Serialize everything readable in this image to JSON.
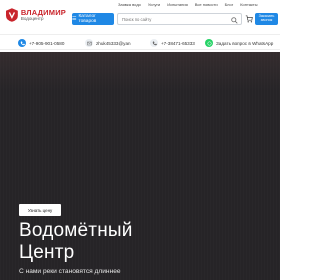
{
  "logo": {
    "title": "ВЛАДИМИР",
    "subtitle": "Водоцентр"
  },
  "menu": {
    "items": [
      "Заявка водо",
      "Услуги",
      "Испытания",
      "Все новости",
      "Блог",
      "Контакты"
    ]
  },
  "catalog_button": {
    "label": "Каталог товаров"
  },
  "search": {
    "placeholder": "Поиск по сайту"
  },
  "callback_button": {
    "label": "Заказать звонок"
  },
  "contacts": {
    "phone1": "+7-905-901-0580",
    "email": "zhuk45333@yan",
    "phone2": "+7-38471-65333",
    "whatsapp": "Задать вопрос в WhatsApp"
  },
  "hero": {
    "button": "Узнать цену",
    "title_line1": "Водомётный",
    "title_line2": "Центр",
    "subtitle": "С нами реки становятся длиннее"
  },
  "colors": {
    "accent": "#1f88e5",
    "brand_red": "#c9242b",
    "hero_bg": "#262427"
  }
}
